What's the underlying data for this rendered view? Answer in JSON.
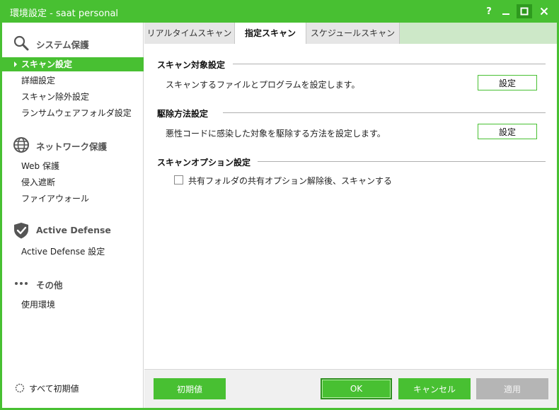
{
  "window": {
    "title": "環境設定 - saat personal",
    "controls": {
      "help": "?",
      "minimize": "minimize",
      "maximize": "maximize",
      "close": "close"
    }
  },
  "sidebar": {
    "sections": [
      {
        "icon": "search-icon",
        "label": "システム保護",
        "items": [
          {
            "label": "スキャン設定",
            "selected": true
          },
          {
            "label": "詳細設定"
          },
          {
            "label": "スキャン除外設定"
          },
          {
            "label": "ランサムウェアフォルダ設定"
          }
        ]
      },
      {
        "icon": "globe-icon",
        "label": "ネットワーク保護",
        "items": [
          {
            "label": "Web 保護"
          },
          {
            "label": "侵入遮断"
          },
          {
            "label": "ファイアウォール"
          }
        ]
      },
      {
        "icon": "shield-check-icon",
        "label": "Active Defense",
        "items": [
          {
            "label": "Active Defense 設定"
          }
        ]
      },
      {
        "icon": "more-dots-icon",
        "label": "その他",
        "items": [
          {
            "label": "使用環境"
          }
        ]
      }
    ],
    "reset_all": "すべて初期値"
  },
  "tabs": [
    {
      "label": "リアルタイムスキャン",
      "active": false
    },
    {
      "label": "指定スキャン",
      "active": true
    },
    {
      "label": "スケジュールスキャン",
      "active": false
    }
  ],
  "groups": {
    "target": {
      "title": "スキャン対象設定",
      "description": "スキャンするファイルとプログラムを設定します。",
      "button": "設定"
    },
    "method": {
      "title": "駆除方法設定",
      "description": "悪性コードに感染した対象を駆除する方法を設定します。",
      "button": "設定"
    },
    "options": {
      "title": "スキャンオプション設定",
      "checkbox_label": "共有フォルダの共有オプション解除後、スキャンする",
      "checked": false
    }
  },
  "footer": {
    "defaults": "初期値",
    "ok": "OK",
    "cancel": "キャンセル",
    "apply": "適用"
  },
  "colors": {
    "accent": "#48c032",
    "disabled": "#b5b5b5"
  }
}
